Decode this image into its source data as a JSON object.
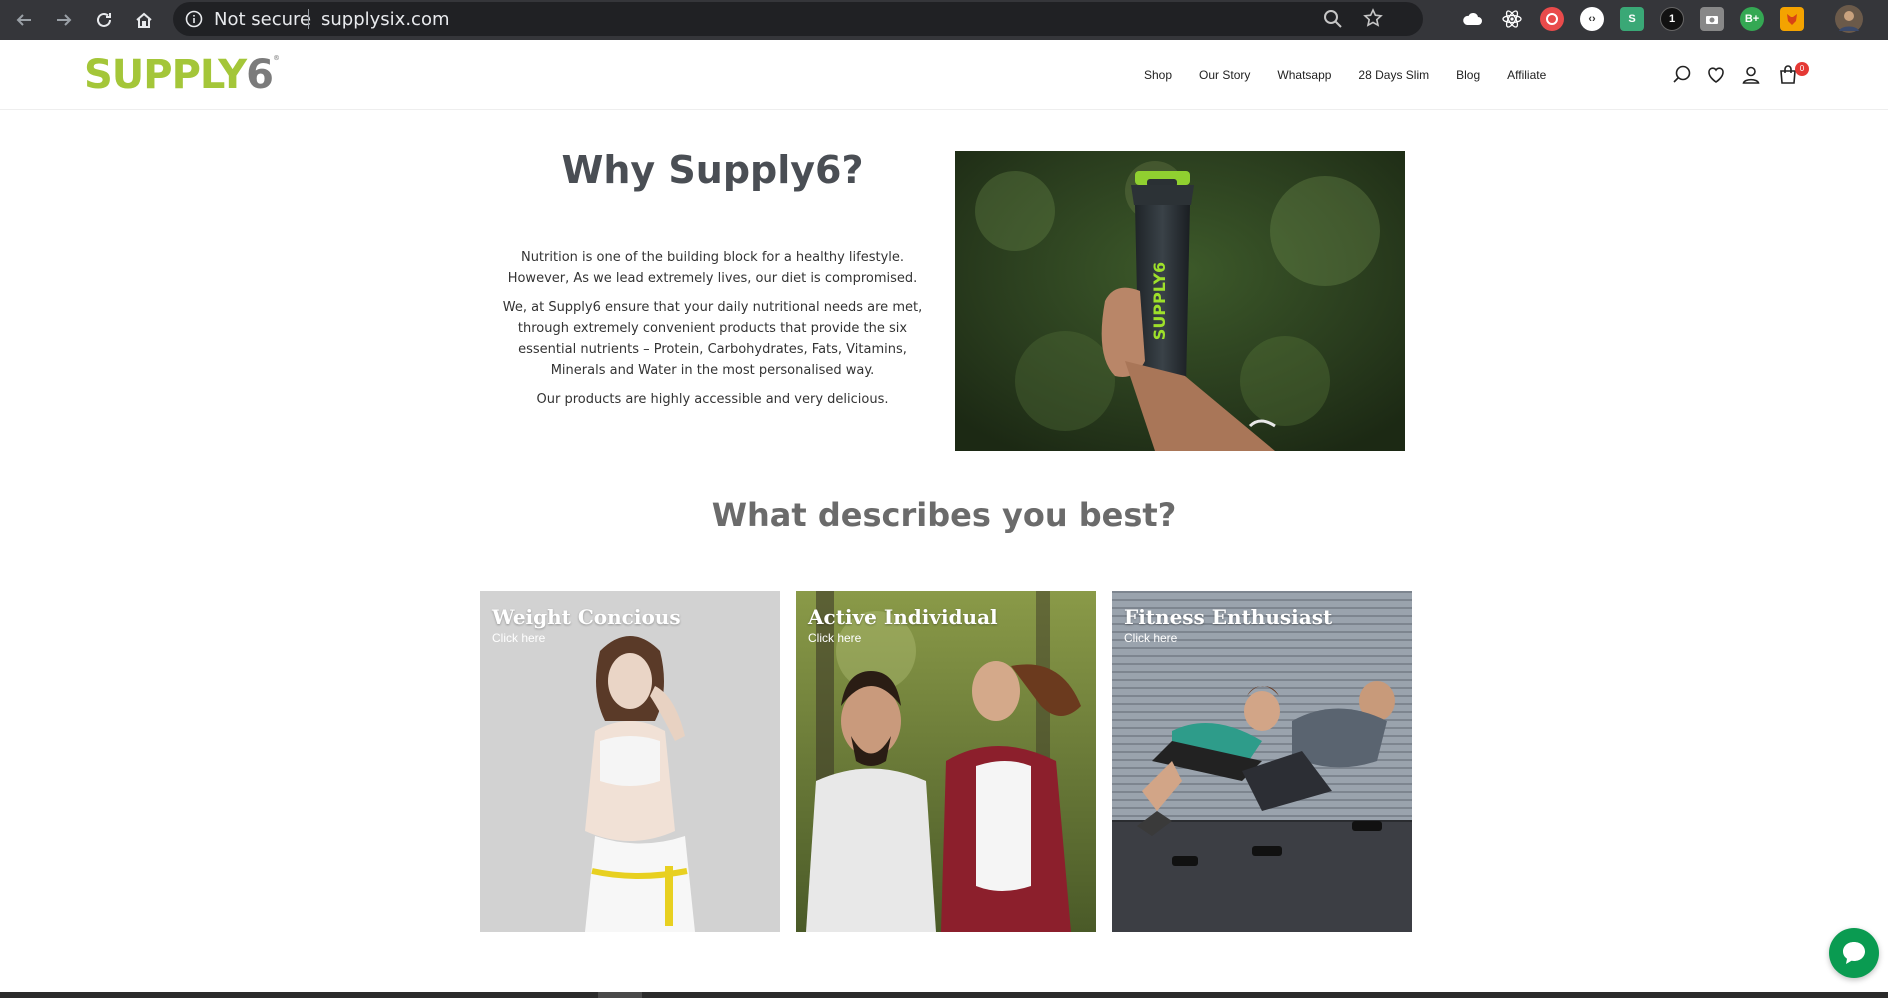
{
  "browser": {
    "back_icon": "arrow-left-icon",
    "forward_icon": "arrow-right-icon",
    "reload_icon": "reload-icon",
    "home_icon": "home-icon",
    "security_label": "Not secure",
    "url": "supplysix.com"
  },
  "header": {
    "logo_main": "SUPPLY",
    "logo_six": "6",
    "logo_reg": "®",
    "nav": [
      "Shop",
      "Our Story",
      "Whatsapp",
      "28 Days Slim",
      "Blog",
      "Affiliate"
    ],
    "cart_count": "0"
  },
  "why": {
    "title": "Why Supply6?",
    "paragraphs": [
      "Nutrition is one of the building block for a healthy lifestyle.  However, As we lead extremely lives, our diet is compromised.",
      "We, at Supply6 ensure that your daily nutritional needs are met, through extremely convenient products that provide the six essential nutrients – Protein, Carbohydrates, Fats, Vitamins, Minerals and Water in the most personalised way.",
      "Our products are highly accessible and very delicious."
    ],
    "bottle_text": "SUPPLY6"
  },
  "describe": {
    "title": "What describes you best?",
    "cards": [
      {
        "title": "Weight Concious",
        "link": "Click here"
      },
      {
        "title": "Active Individual",
        "link": "Click here"
      },
      {
        "title": "Fitness Enthusiast",
        "link": "Click here"
      }
    ]
  },
  "colors": {
    "brand_green": "#a4c639",
    "chat_green": "#0a9b51",
    "badge_red": "#e53935"
  }
}
